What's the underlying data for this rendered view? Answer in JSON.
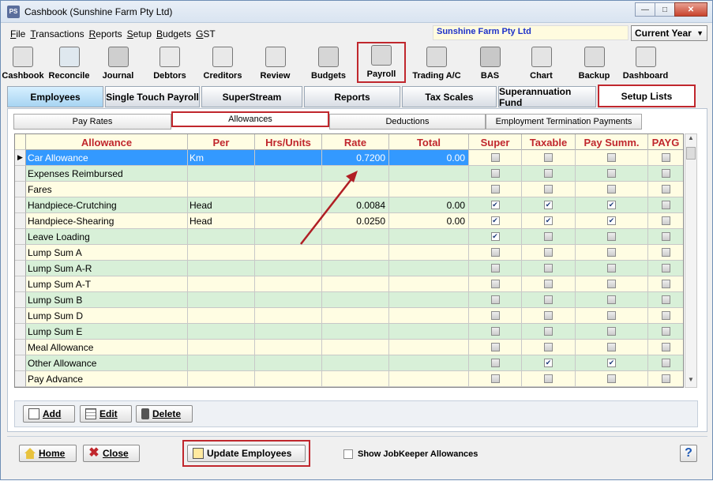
{
  "window": {
    "title": "Cashbook (Sunshine Farm Pty Ltd)",
    "app_icon": "PS"
  },
  "menu": [
    "File",
    "Transactions",
    "Reports",
    "Setup",
    "Budgets",
    "GST"
  ],
  "company": "Sunshine Farm Pty Ltd",
  "period": "Current Year",
  "toolbar": [
    {
      "label": "Cashbook",
      "icon": "cashbook-icon"
    },
    {
      "label": "Reconcile",
      "icon": "reconcile-icon"
    },
    {
      "label": "Journal",
      "icon": "journal-icon"
    },
    {
      "label": "Debtors",
      "icon": "debtors-icon"
    },
    {
      "label": "Creditors",
      "icon": "creditors-icon"
    },
    {
      "label": "Review",
      "icon": "review-icon"
    },
    {
      "label": "Budgets",
      "icon": "budgets-icon"
    },
    {
      "label": "Payroll",
      "icon": "payroll-icon"
    },
    {
      "label": "Trading A/C",
      "icon": "trading-icon"
    },
    {
      "label": "BAS",
      "icon": "bas-icon"
    },
    {
      "label": "Chart",
      "icon": "chart-icon"
    },
    {
      "label": "Backup",
      "icon": "backup-icon"
    },
    {
      "label": "Dashboard",
      "icon": "dashboard-icon"
    }
  ],
  "main_tabs": [
    "Employees",
    "Single Touch Payroll",
    "SuperStream",
    "Reports",
    "Tax Scales",
    "Superannuation Fund",
    "Setup Lists"
  ],
  "sub_tabs": [
    "Pay Rates",
    "Allowances",
    "Deductions",
    "Employment Termination Payments"
  ],
  "columns": [
    "Allowance",
    "Per",
    "Hrs/Units",
    "Rate",
    "Total",
    "Super",
    "Taxable",
    "Pay Summ.",
    "PAYG"
  ],
  "rows": [
    {
      "name": "Car Allowance",
      "per": "Km",
      "units": "",
      "rate": "0.7200",
      "total": "0.00",
      "super": false,
      "taxable": false,
      "paysumm": false,
      "payg": false,
      "selected": true
    },
    {
      "name": "Expenses Reimbursed",
      "per": "",
      "units": "",
      "rate": "",
      "total": "",
      "super": false,
      "taxable": false,
      "paysumm": false,
      "payg": false
    },
    {
      "name": "Fares",
      "per": "",
      "units": "",
      "rate": "",
      "total": "",
      "super": false,
      "taxable": false,
      "paysumm": false,
      "payg": false
    },
    {
      "name": "Handpiece-Crutching",
      "per": "Head",
      "units": "",
      "rate": "0.0084",
      "total": "0.00",
      "super": true,
      "taxable": true,
      "paysumm": true,
      "payg": false
    },
    {
      "name": "Handpiece-Shearing",
      "per": "Head",
      "units": "",
      "rate": "0.0250",
      "total": "0.00",
      "super": true,
      "taxable": true,
      "paysumm": true,
      "payg": false
    },
    {
      "name": "Leave Loading",
      "per": "",
      "units": "",
      "rate": "",
      "total": "",
      "super": true,
      "taxable": false,
      "paysumm": false,
      "payg": false
    },
    {
      "name": "Lump Sum A",
      "per": "",
      "units": "",
      "rate": "",
      "total": "",
      "super": false,
      "taxable": false,
      "paysumm": false,
      "payg": false
    },
    {
      "name": "Lump Sum A-R",
      "per": "",
      "units": "",
      "rate": "",
      "total": "",
      "super": false,
      "taxable": false,
      "paysumm": false,
      "payg": false
    },
    {
      "name": "Lump Sum A-T",
      "per": "",
      "units": "",
      "rate": "",
      "total": "",
      "super": false,
      "taxable": false,
      "paysumm": false,
      "payg": false
    },
    {
      "name": "Lump Sum B",
      "per": "",
      "units": "",
      "rate": "",
      "total": "",
      "super": false,
      "taxable": false,
      "paysumm": false,
      "payg": false
    },
    {
      "name": "Lump Sum D",
      "per": "",
      "units": "",
      "rate": "",
      "total": "",
      "super": false,
      "taxable": false,
      "paysumm": false,
      "payg": false
    },
    {
      "name": "Lump Sum E",
      "per": "",
      "units": "",
      "rate": "",
      "total": "",
      "super": false,
      "taxable": false,
      "paysumm": false,
      "payg": false
    },
    {
      "name": "Meal Allowance",
      "per": "",
      "units": "",
      "rate": "",
      "total": "",
      "super": false,
      "taxable": false,
      "paysumm": false,
      "payg": false
    },
    {
      "name": "Other Allowance",
      "per": "",
      "units": "",
      "rate": "",
      "total": "",
      "super": false,
      "taxable": true,
      "paysumm": true,
      "payg": false
    },
    {
      "name": "Pay Advance",
      "per": "",
      "units": "",
      "rate": "",
      "total": "",
      "super": false,
      "taxable": false,
      "paysumm": false,
      "payg": false
    }
  ],
  "actions": {
    "add": "Add",
    "edit": "Edit",
    "delete": "Delete"
  },
  "footer": {
    "home": "Home",
    "close": "Close",
    "update": "Update Employees",
    "jobkeeper": "Show JobKeeper Allowances",
    "help": "?"
  },
  "colors": {
    "highlight": "#c0272d",
    "selected_row": "#3399ff",
    "row_alt": "#d8f0d8",
    "row_base": "#fffde3",
    "header_text": "#c0272d"
  }
}
